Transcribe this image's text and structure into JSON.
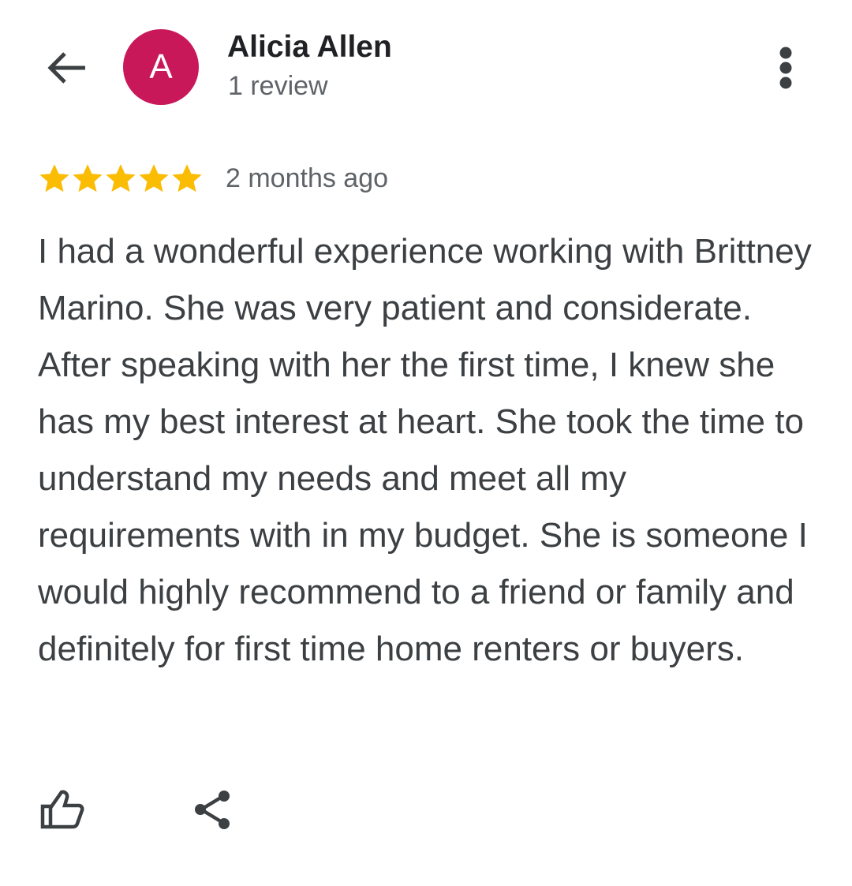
{
  "header": {
    "back_icon": "arrow-back-icon",
    "avatar_letter": "A",
    "avatar_color": "#c8185a",
    "author_name": "Alicia Allen",
    "review_count": "1 review",
    "more_icon": "more-vert-icon"
  },
  "review": {
    "rating": 5,
    "rating_max": 5,
    "star_color": "#fbbc04",
    "date": "2 months ago",
    "text": "I had a wonderful experience working with Brittney Marino. She was very patient and considerate. After speaking with her the first time, I knew she has my best interest at heart. She took the time to understand my needs and meet all my requirements with in my budget. She is someone I would highly recommend to a friend or family and definitely for first time home renters or buyers."
  },
  "actions": {
    "like_icon": "thumb-up-icon",
    "share_icon": "share-icon"
  },
  "colors": {
    "primary_text": "#202124",
    "body_text": "#3c4043",
    "secondary_text": "#5f6368",
    "icon": "#3c4043"
  }
}
